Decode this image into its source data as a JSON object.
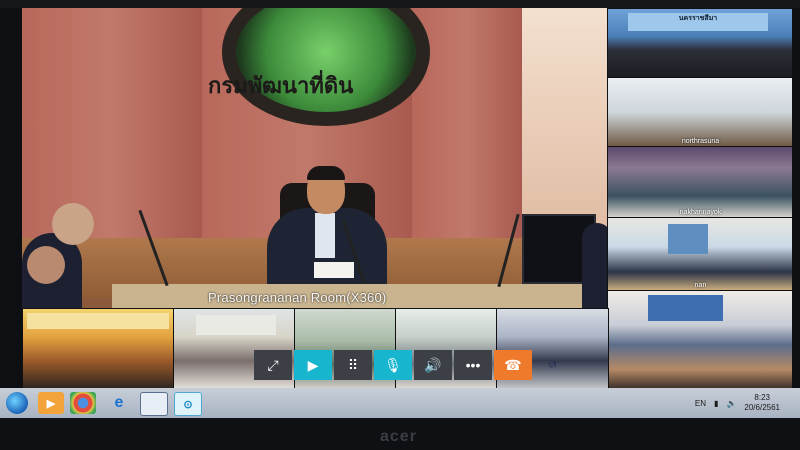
{
  "main_video": {
    "room_label": "Prasongrananan Room(X360)",
    "logo_text": "กรมพัฒนาที่ดิน"
  },
  "side_tiles": [
    {
      "label": "นครราชสีมา"
    },
    {
      "label": "northrasuna"
    },
    {
      "label": "nakhannayok"
    },
    {
      "label": "nan"
    },
    {
      "label": ""
    }
  ],
  "bottom_tiles": [
    {
      "label": ""
    },
    {
      "label": ""
    },
    {
      "label": ""
    },
    {
      "label": ""
    },
    {
      "label": "บุรี"
    }
  ],
  "call_toolbar": {
    "buttons": [
      {
        "name": "fullscreen",
        "glyph": "⤢"
      },
      {
        "name": "video",
        "glyph": "▶"
      },
      {
        "name": "dialpad",
        "glyph": "⠿"
      },
      {
        "name": "mute",
        "glyph": "🎙"
      },
      {
        "name": "volume",
        "glyph": "🔊"
      },
      {
        "name": "more",
        "glyph": "•••"
      },
      {
        "name": "hangup",
        "glyph": "☎"
      }
    ]
  },
  "taskbar": {
    "apps": [
      "media-player-icon",
      "chrome-icon",
      "internet-explorer-icon",
      "display-icon",
      "video-conference-icon"
    ],
    "language": "EN",
    "time": "8:23",
    "date": "20/6/2561"
  },
  "monitor_brand": "acer",
  "colors": {
    "accent_teal": "#18b5cf",
    "hangup_orange": "#f07a2c",
    "toolbar_gray": "#3c3f45"
  }
}
